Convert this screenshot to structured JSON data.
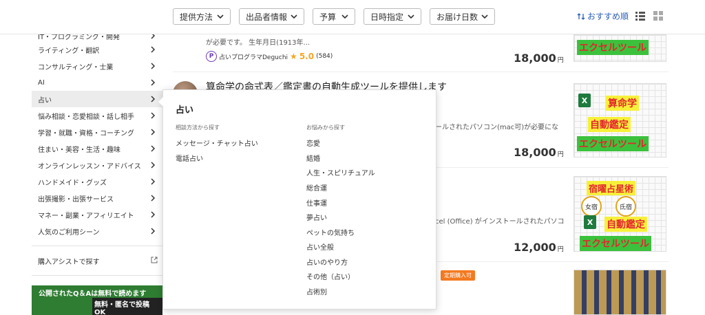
{
  "filters": [
    {
      "label": "提供方法"
    },
    {
      "label": "出品者情報"
    },
    {
      "label": "予算"
    },
    {
      "label": "日時指定"
    },
    {
      "label": "お届け日数"
    }
  ],
  "sort": {
    "label": "おすすめ順"
  },
  "sidebar": {
    "items": [
      {
        "label": "IT・プログラミング・開発"
      },
      {
        "label": "ライティング・翻訳"
      },
      {
        "label": "コンサルティング・士業"
      },
      {
        "label": "AI"
      },
      {
        "label": "占い"
      },
      {
        "label": "悩み相談・恋愛相談・話し相手"
      },
      {
        "label": "学習・就職・資格・コーチング"
      },
      {
        "label": "住まい・美容・生活・趣味"
      },
      {
        "label": "オンラインレッスン・アドバイス"
      },
      {
        "label": "ハンドメイド・グッズ"
      },
      {
        "label": "出張撮影・出張サービス"
      },
      {
        "label": "マネー・副業・アフィリエイト"
      },
      {
        "label": "人気のご利用シーン"
      }
    ],
    "assist": "購入アシストで探す",
    "banner_line1": "公開されたQ＆Aは無料で読めます",
    "banner_line2": "無料・匿名で投稿OK"
  },
  "popup": {
    "title": "占い",
    "col1_head": "相談方法から探す",
    "col1": [
      "メッセージ・チャット占い",
      "電話占い"
    ],
    "col2_head": "お悩みから探す",
    "col2": [
      "恋愛",
      "結婚",
      "人生・スピリチュアル",
      "総合運",
      "仕事運",
      "夢占い",
      "ペットの気持ち",
      "占い全般",
      "占いのやり方",
      "その他（占い）",
      "占術別"
    ]
  },
  "listings": [
    {
      "desc": "が必要です。 生年月日(1913年...",
      "seller": "占いプログラマDeguchi",
      "rating": "5.0",
      "reviews": "(584)",
      "price": "18,000",
      "yen": "円",
      "thumb_label": "エクセルツール"
    },
    {
      "title": "算命学の命式表／鑑定書の自動生成ツールを提供します",
      "desc": "ールされたパソコン(mac可)が必要にな",
      "price": "18,000",
      "yen": "円",
      "thumb_labels": [
        "算命学",
        "自動鑑定",
        "エクセルツール"
      ]
    },
    {
      "desc": "cel (Office) がインストールされたパソコ",
      "price": "12,000",
      "yen": "円",
      "thumb_labels": [
        "宿曜占星術",
        "女宿",
        "氐宿",
        "自動鑑定",
        "エクセルツール"
      ]
    },
    {
      "tag": "定期購入可"
    }
  ],
  "colors": {
    "accent_blue": "#2a5fb8",
    "excel_green": "#1f7a3d",
    "label_green": "#3cc13c",
    "label_yellow": "#f7f03a",
    "label_red": "#e3262e",
    "tag_orange": "#f47a20",
    "star": "#f5a623"
  }
}
